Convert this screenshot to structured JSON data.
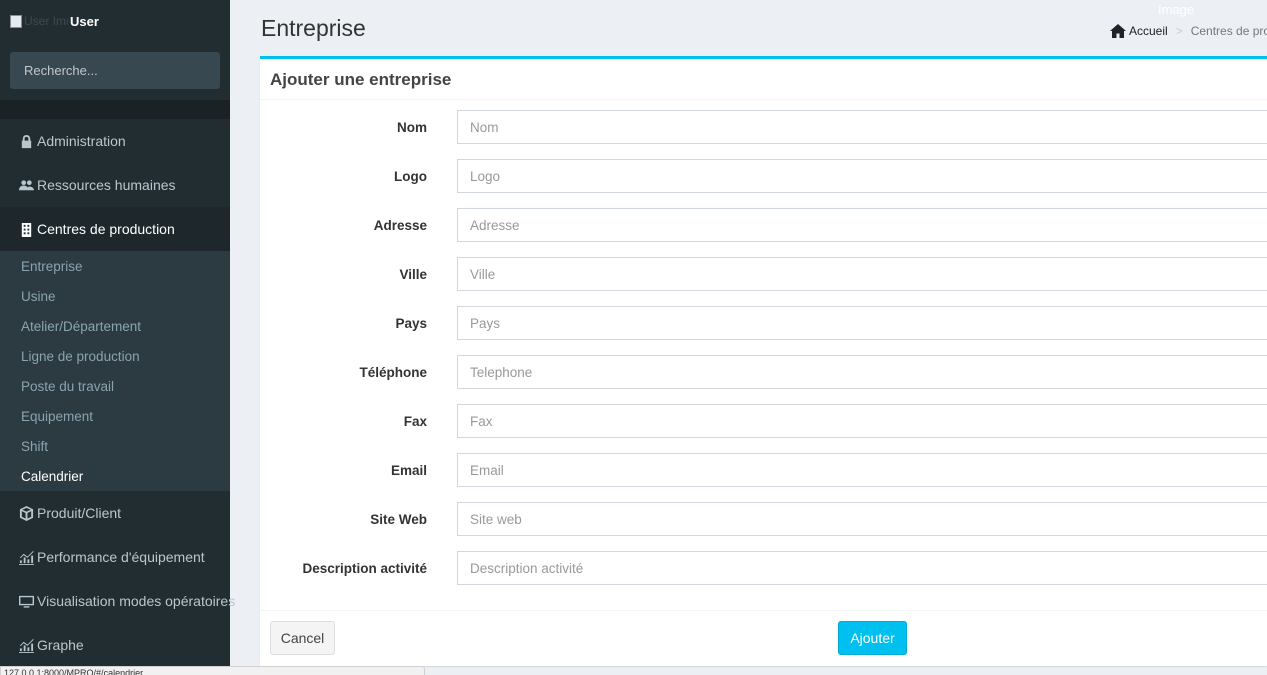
{
  "sidebar": {
    "user_image_alt": "User Image",
    "user_name": "User",
    "search_placeholder": "Recherche...",
    "menu": [
      {
        "label": "Administration",
        "icon": "lock-icon"
      },
      {
        "label": "Ressources humaines",
        "icon": "users-icon"
      },
      {
        "label": "Centres de production",
        "icon": "building-icon"
      },
      {
        "label": "Produit/Client",
        "icon": "cube-icon"
      },
      {
        "label": "Performance d'équipement",
        "icon": "chart-icon"
      },
      {
        "label": "Visualisation modes opératoires",
        "icon": "monitor-icon"
      },
      {
        "label": "Graphe",
        "icon": "chart-icon"
      }
    ],
    "submenu": [
      "Entreprise",
      "Usine",
      "Atelier/Département",
      "Ligne de production",
      "Poste du travail",
      "Equipement",
      "Shift",
      "Calendrier"
    ]
  },
  "header": {
    "title": "Entreprise",
    "image_label": "Image",
    "breadcrumb_home": "Accueil",
    "breadcrumb_sep": ">",
    "breadcrumb_current": "Centres de production"
  },
  "form": {
    "title": "Ajouter une entreprise",
    "fields": [
      {
        "label": "Nom",
        "placeholder": "Nom"
      },
      {
        "label": "Logo",
        "placeholder": "Logo"
      },
      {
        "label": "Adresse",
        "placeholder": "Adresse"
      },
      {
        "label": "Ville",
        "placeholder": "Ville"
      },
      {
        "label": "Pays",
        "placeholder": "Pays"
      },
      {
        "label": "Téléphone",
        "placeholder": "Telephone"
      },
      {
        "label": "Fax",
        "placeholder": "Fax"
      },
      {
        "label": "Email",
        "placeholder": "Email"
      },
      {
        "label": "Site Web",
        "placeholder": "Site web"
      },
      {
        "label": "Description activité",
        "placeholder": "Description activité"
      }
    ],
    "cancel_label": "Cancel",
    "submit_label": "Ajouter"
  },
  "status_bar": "127.0.0.1:8000/MPRO/#/calendrier",
  "colors": {
    "accent": "#00c0ef",
    "sidebar_bg": "#222d32",
    "submenu_bg": "#2c3b41",
    "page_bg": "#ecf0f5"
  }
}
